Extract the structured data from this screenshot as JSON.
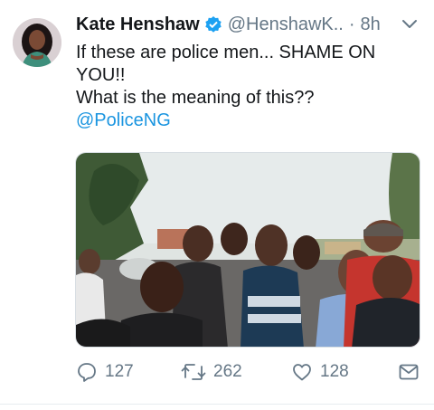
{
  "tweet": {
    "author": {
      "display_name": "Kate Henshaw",
      "handle": "@HenshawK..",
      "verified": true,
      "avatar_icon": "avatar-icon"
    },
    "separator": "·",
    "time": "8h",
    "text_lines": [
      "If these are police men... SHAME ON",
      "YOU!!",
      "What is the meaning of this??"
    ],
    "mention": "@PoliceNG",
    "media": {
      "description_icon": "photo-icon"
    },
    "actions": {
      "reply_count": "127",
      "retweet_count": "262",
      "like_count": "128"
    }
  },
  "colors": {
    "verified": "#1da1f2",
    "mention": "#1b95e0",
    "muted": "#657786",
    "text": "#14171a"
  }
}
